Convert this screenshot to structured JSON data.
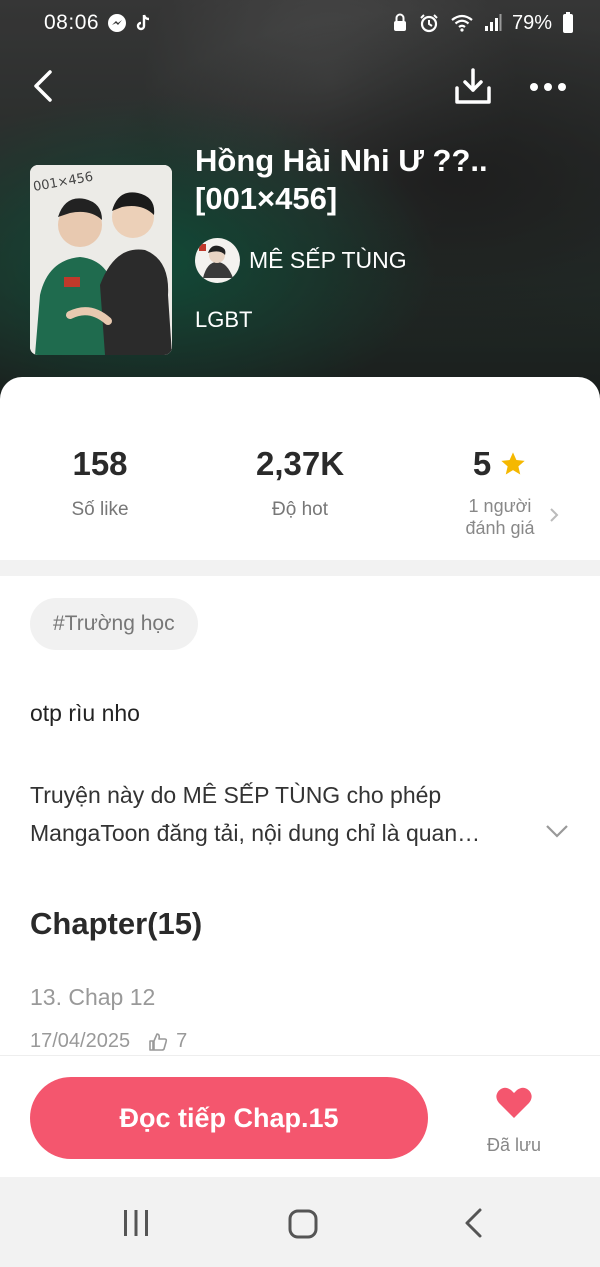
{
  "status_bar": {
    "time": "08:06",
    "battery": "79%"
  },
  "book": {
    "title_line1": "Hồng Hài Nhi Ư ??..",
    "title_line2": "[001×456]",
    "author": "MÊ SẾP TÙNG",
    "genre": "LGBT"
  },
  "stats": {
    "likes_value": "158",
    "likes_label": "Số like",
    "hot_value": "2,37K",
    "hot_label": "Độ hot",
    "rating_value": "5",
    "rating_label_line1": "1 người",
    "rating_label_line2": "đánh giá"
  },
  "tag": "#Trường học",
  "description": {
    "short": "otp rìu nho",
    "long_line1": "Truyện này do MÊ SẾP TÙNG cho phép",
    "long_line2": "MangaToon đăng tải, nội dung chỉ là quan…"
  },
  "chapters": {
    "heading": "Chapter(15)",
    "latest_title": "13. Chap 12",
    "latest_date": "17/04/2025",
    "latest_likes": "7"
  },
  "actions": {
    "read_label": "Đọc tiếp Chap.15",
    "saved_label": "Đã lưu"
  },
  "colors": {
    "accent": "#f4566e",
    "star": "#f5b800"
  }
}
